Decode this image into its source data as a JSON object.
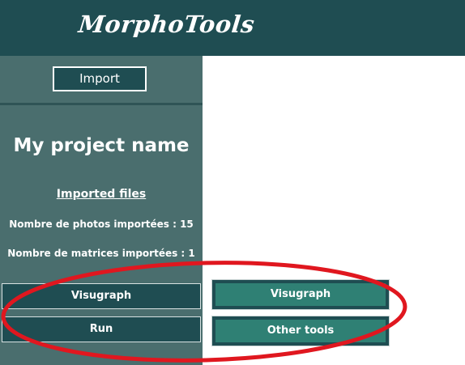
{
  "header": {
    "app_title": "MorphoTools"
  },
  "sidebar": {
    "import_label": "Import",
    "project_name": "My project name",
    "imported_files_label": "Imported files",
    "photos_count_text": "Nombre de photos importées : 15",
    "matrices_count_text": "Nombre de matrices importées : 1",
    "visugraph_label": "Visugraph",
    "run_label": "Run"
  },
  "main": {
    "visugraph_label": "Visugraph",
    "other_tools_label": "Other tools"
  },
  "colors": {
    "header_bg": "#1f4d52",
    "sidebar_bg": "#4a6e6e",
    "button_dark": "#1f4d52",
    "button_teal": "#2f8074",
    "annotation_red": "#e0171f"
  }
}
